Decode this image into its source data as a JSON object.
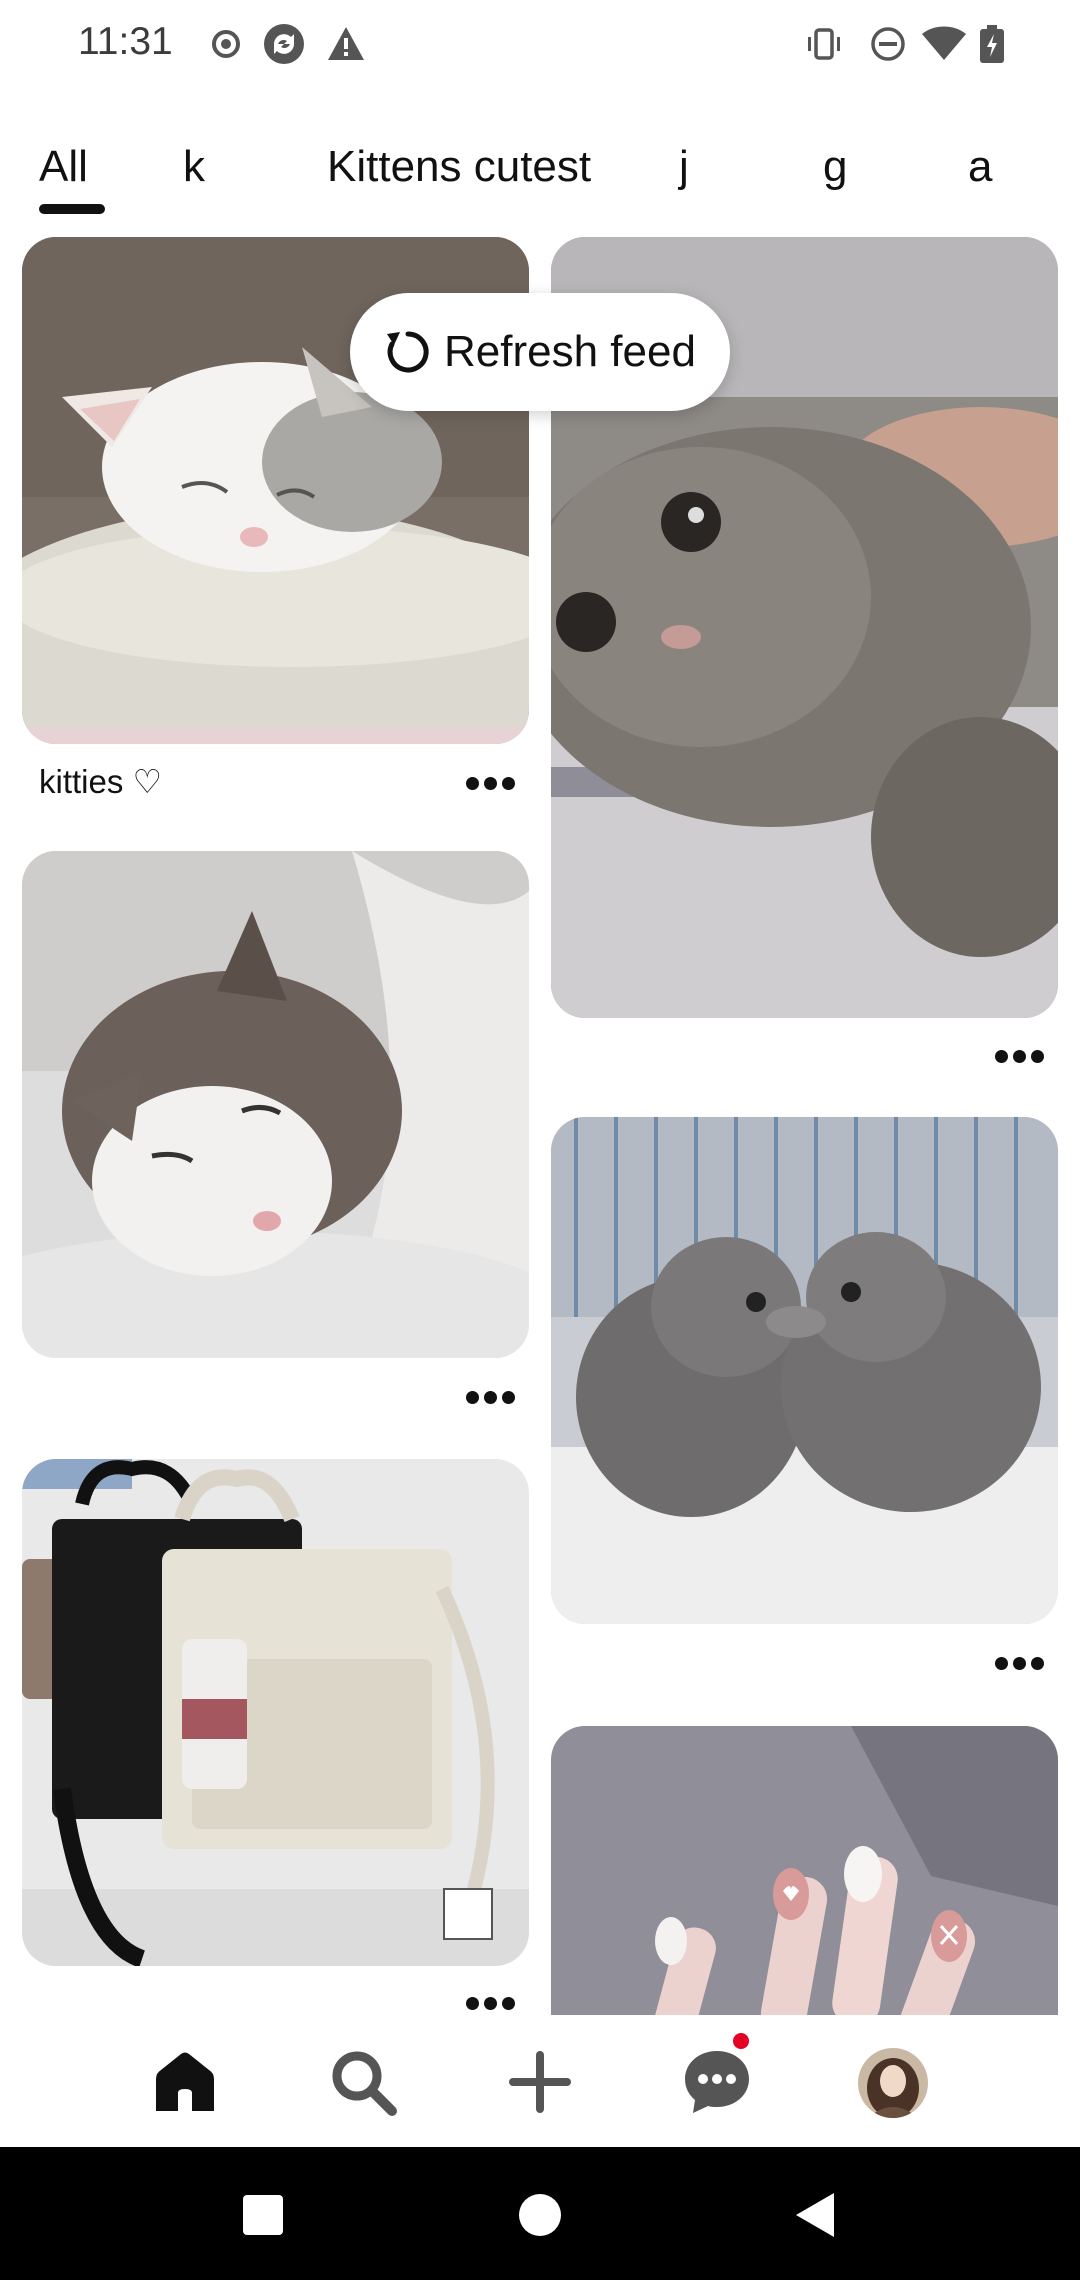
{
  "status_bar": {
    "time": "11:31",
    "left_icons": [
      "record-icon",
      "sync-icon",
      "warning-icon"
    ],
    "right_icons": [
      "vibrate-icon",
      "do-not-disturb-icon",
      "wifi-icon",
      "battery-icon"
    ]
  },
  "tabs": {
    "items": [
      "All",
      "k",
      "Kittens cutest",
      "j",
      "g",
      "a"
    ],
    "selected": "All"
  },
  "refresh_feed": {
    "label": "Refresh feed",
    "icon": "refresh-icon"
  },
  "feed": {
    "pins": [
      {
        "caption": "kitties ♡"
      },
      {
        "caption": ""
      },
      {
        "caption": ""
      },
      {
        "caption": ""
      },
      {
        "caption": ""
      },
      {
        "caption": ""
      }
    ],
    "more_icon": "more-horizontal-icon"
  },
  "bottom_nav": {
    "items": [
      "home-icon",
      "search-icon",
      "add-icon",
      "messages-icon",
      "profile-avatar"
    ],
    "selected": "home-icon",
    "has_message_notification": true
  },
  "system_nav": [
    "recents-icon",
    "home-circle-icon",
    "back-icon"
  ],
  "colors": {
    "accent": "#e60023",
    "text": "#111111",
    "background": "#ffffff"
  }
}
